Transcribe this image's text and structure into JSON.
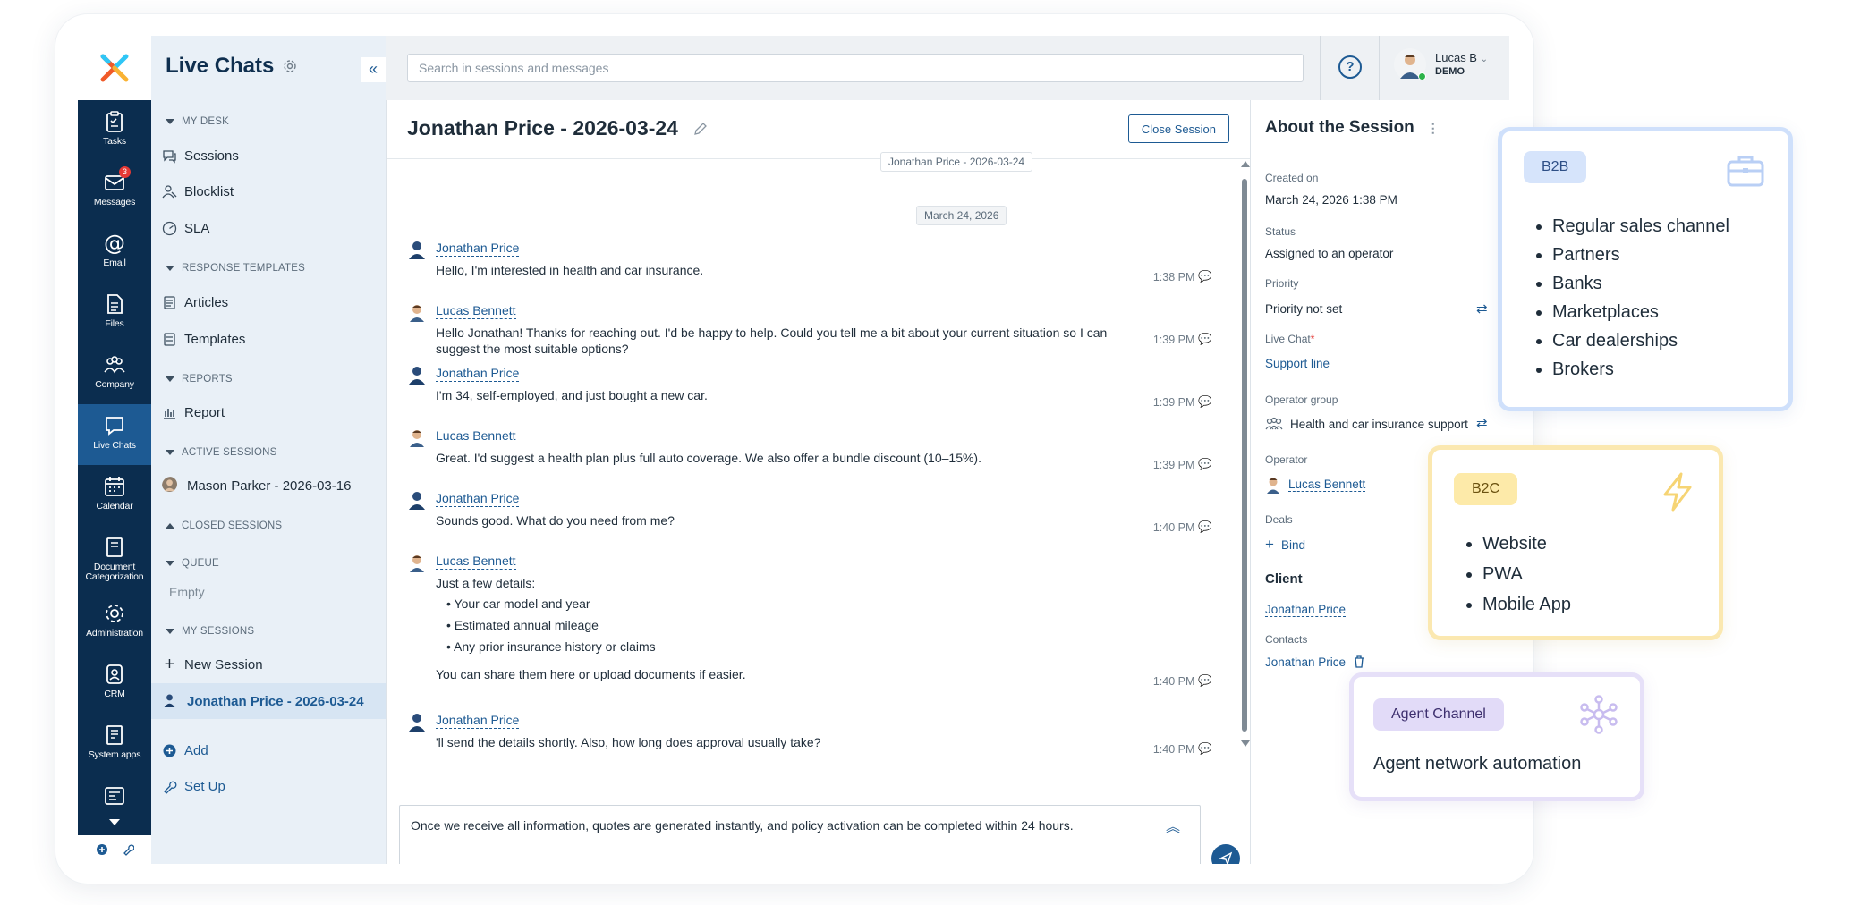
{
  "nav": {
    "title": "Live Chats",
    "collapse_glyph": "«",
    "sections": {
      "my_desk": "MY DESK",
      "response_templates": "RESPONSE TEMPLATES",
      "reports": "REPORTS",
      "active_sessions": "ACTIVE SESSIONS",
      "closed_sessions": "CLOSED SESSIONS",
      "queue": "QUEUE",
      "my_sessions": "MY SESSIONS"
    },
    "items": {
      "sessions": "Sessions",
      "blocklist": "Blocklist",
      "sla": "SLA",
      "articles": "Articles",
      "templates": "Templates",
      "report": "Report",
      "active_session": "Mason Parker - 2026-03-16",
      "queue_empty": "Empty",
      "new_session": "New Session",
      "current_session": "Jonathan Price - 2026-03-24",
      "add": "Add",
      "setup": "Set Up"
    }
  },
  "rail": {
    "items": [
      "Tasks",
      "Messages",
      "Email",
      "Files",
      "Company",
      "Live Chats",
      "Calendar",
      "Document Categorization",
      "Administration",
      "CRM",
      "System apps"
    ],
    "messages_badge": "3"
  },
  "topbar": {
    "search_placeholder": "Search in sessions and messages",
    "help": "?",
    "user_name": "Lucas B",
    "user_sub": "DEMO"
  },
  "chat": {
    "title": "Jonathan Price - 2026-03-24",
    "close_button": "Close Session",
    "sticky_date": "Jonathan Price - 2026-03-24",
    "date_chip": "March 24, 2026",
    "messages": [
      {
        "author": "Jonathan Price",
        "text": "Hello, I'm interested in health and car insurance.",
        "time": "1:38 PM"
      },
      {
        "author": "Lucas Bennett",
        "text": "Hello Jonathan! Thanks for reaching out. I'd be happy to help. Could you tell me a bit about your current situation so I can suggest the most suitable options?",
        "time": "1:39 PM"
      },
      {
        "author": "Jonathan Price",
        "text": "I'm 34, self-employed, and just bought a new car.",
        "time": "1:39 PM"
      },
      {
        "author": "Lucas Bennett",
        "text": "Great. I'd suggest a health plan plus full auto coverage. We also offer a bundle discount (10–15%).",
        "time": "1:39 PM"
      },
      {
        "author": "Jonathan Price",
        "text": "Sounds good. What do you need from me?",
        "time": "1:40 PM"
      },
      {
        "author": "Lucas Bennett",
        "text": "Just a few details:",
        "bullets": [
          "Your car model and year",
          "Estimated annual mileage",
          "Any prior insurance history or claims"
        ],
        "after": "You can share them here or upload documents if easier.",
        "time": "1:40 PM"
      },
      {
        "author": "Jonathan Price",
        "text": "'ll send the details shortly. Also, how long does approval usually take?",
        "time": "1:40 PM"
      }
    ],
    "composer_text": "Once we receive all information, quotes are generated instantly, and policy activation can be completed within 24 hours."
  },
  "about": {
    "title": "About the Session",
    "created_label": "Created on",
    "created_value": "March 24, 2026 1:38 PM",
    "status_label": "Status",
    "status_value": "Assigned to an operator",
    "priority_label": "Priority",
    "priority_value": "Priority not set",
    "livechat_label": "Live Chat",
    "livechat_req": "*",
    "livechat_value": "Support line",
    "group_label": "Operator group",
    "group_value": "Health and car insurance support",
    "operator_label": "Operator",
    "operator_value": "Lucas Bennett",
    "deals_label": "Deals",
    "deals_bind": "Bind",
    "client_header": "Client",
    "client_name": "Jonathan Price",
    "contacts_label": "Contacts",
    "contact_value": "Jonathan Price"
  },
  "cards": {
    "b2b": {
      "badge": "B2B",
      "items": [
        "Regular sales channel",
        "Partners",
        "Banks",
        "Marketplaces",
        "Car dealerships",
        "Brokers"
      ]
    },
    "b2c": {
      "badge": "B2C",
      "items": [
        "Website",
        "PWA",
        "Mobile App"
      ]
    },
    "agent": {
      "badge": "Agent Channel",
      "text": "Agent network automation"
    }
  },
  "colors": {
    "brand": "#1d5a93",
    "rail": "#0b2d4f",
    "b2b": "#cfe0fb",
    "b2c": "#fbe8b0",
    "agent": "#e6e0f8"
  }
}
